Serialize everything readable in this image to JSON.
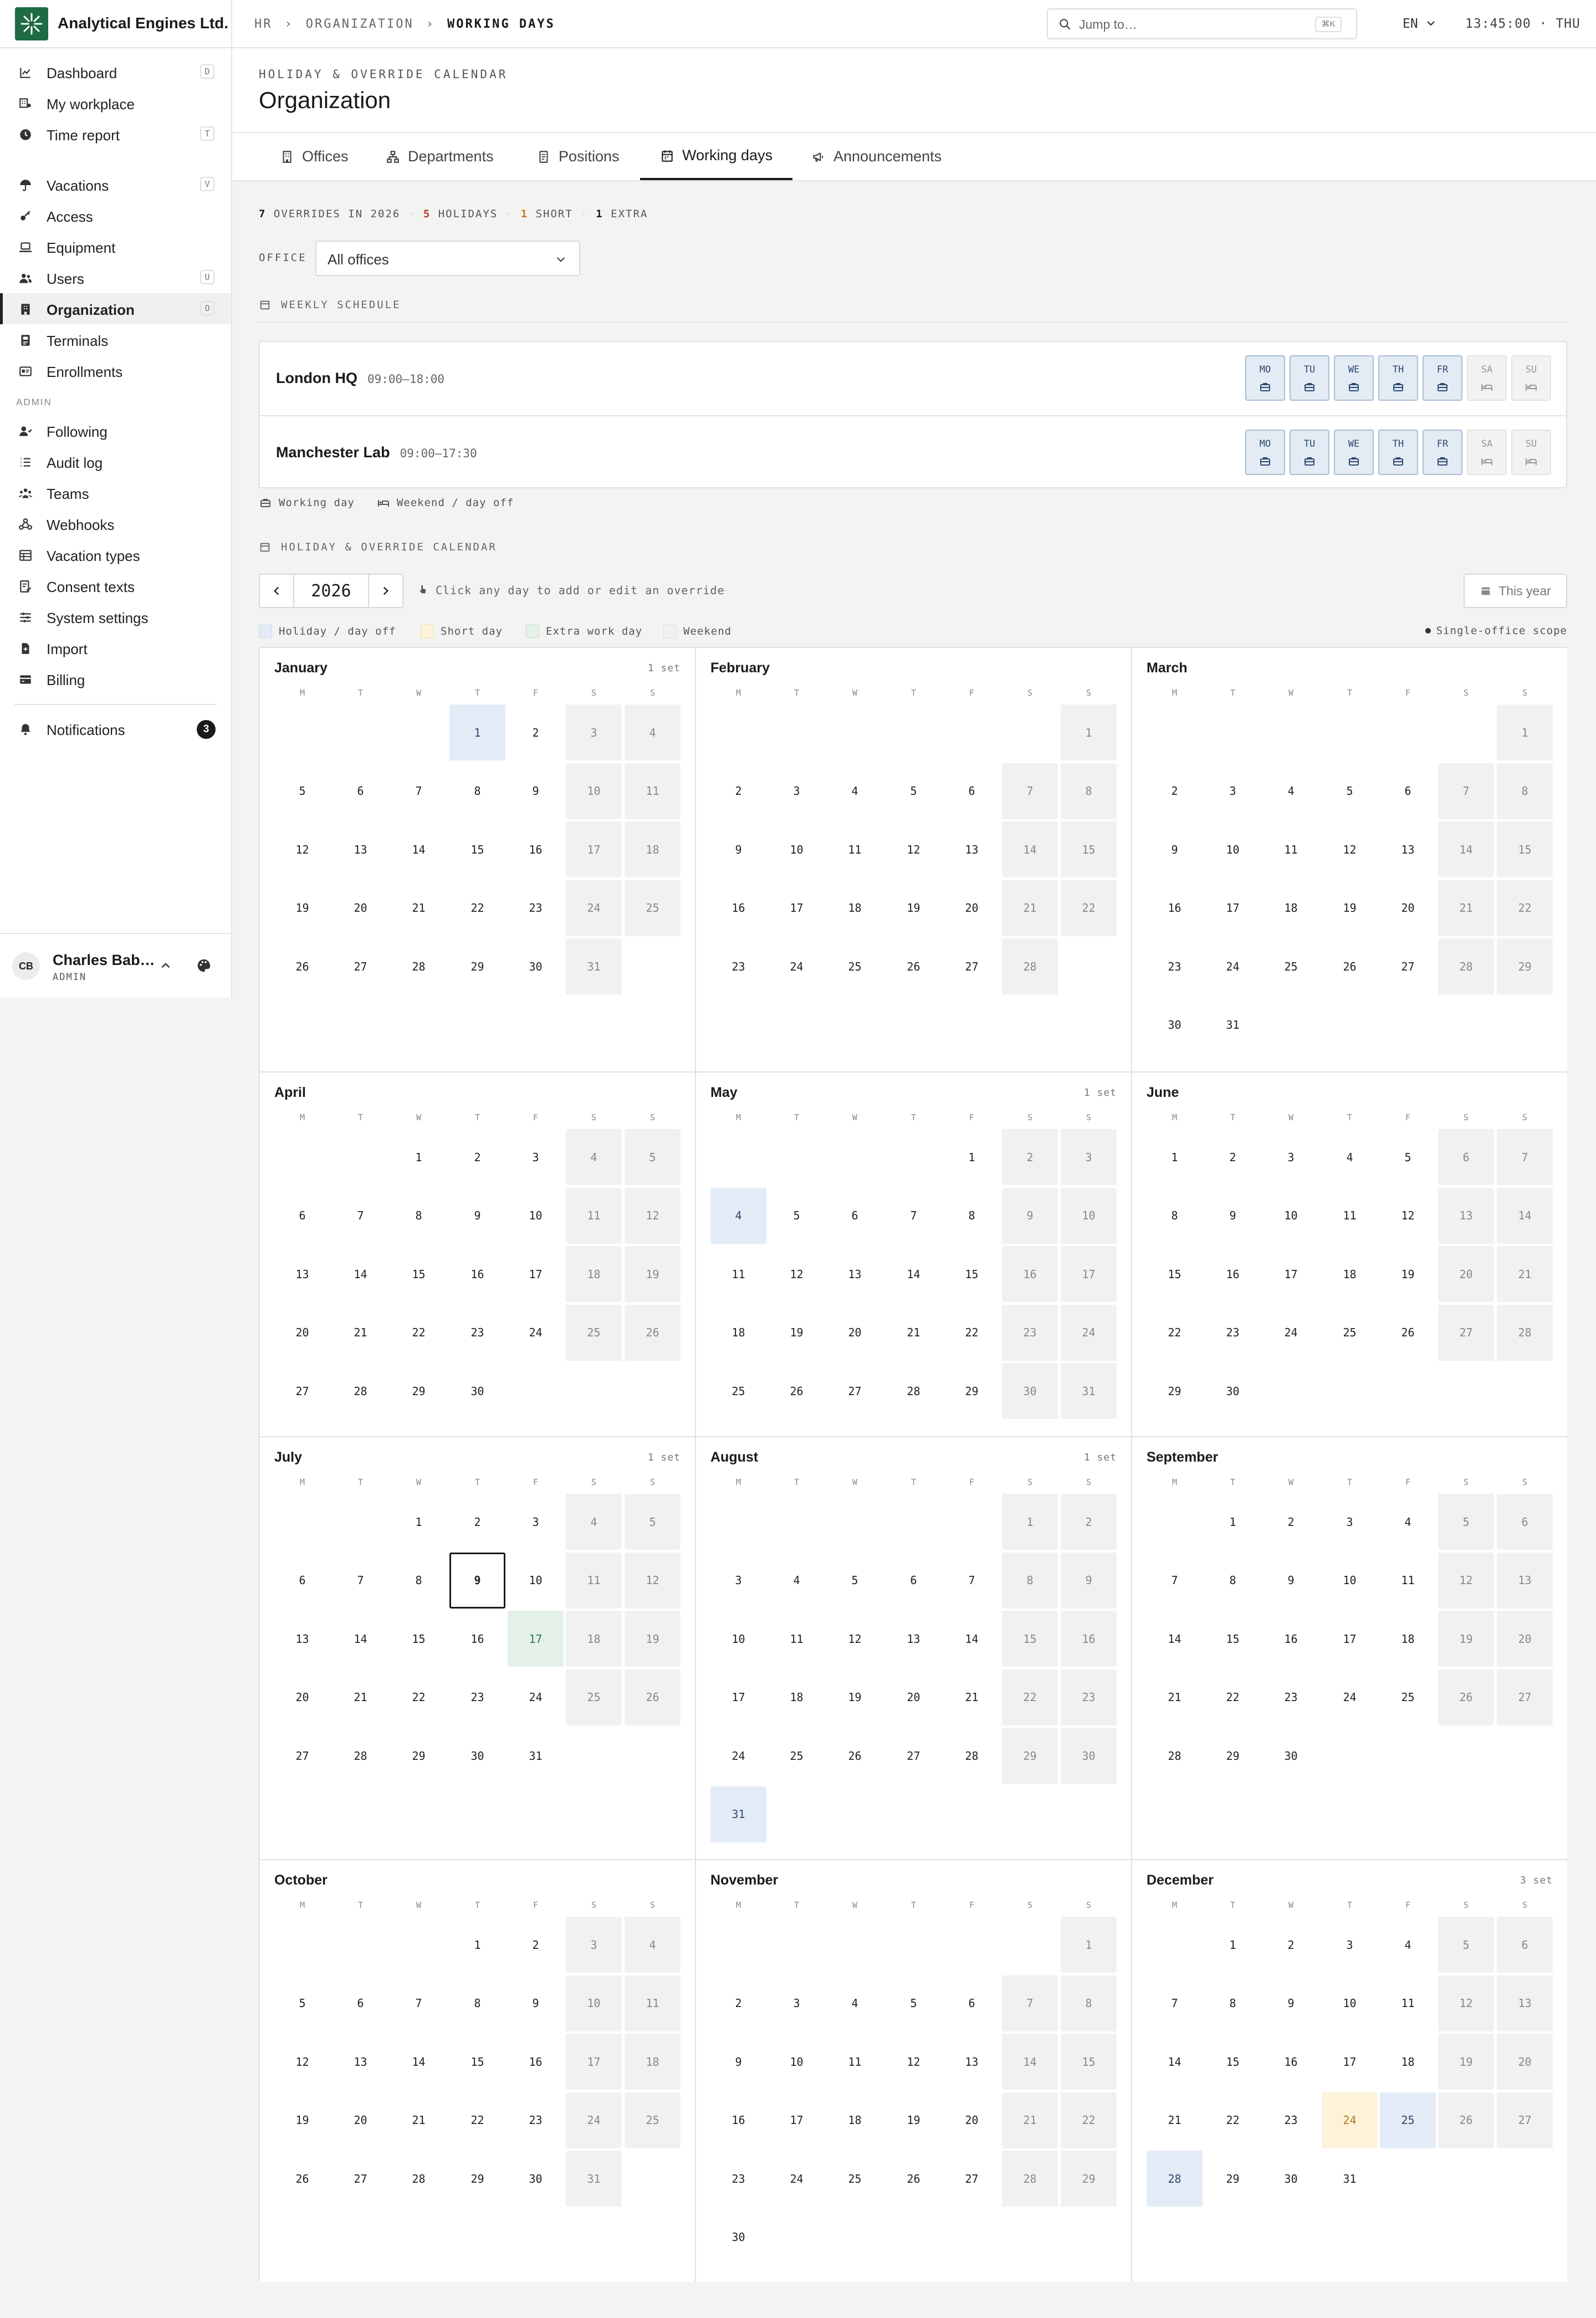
{
  "brand": {
    "name": "Analytical Engines Ltd.",
    "logo_color": "#1f6b43"
  },
  "breadcrumbs": [
    "HR",
    "ORGANIZATION",
    "WORKING DAYS"
  ],
  "search": {
    "placeholder": "Jump to…",
    "shortcut": "⌘K"
  },
  "language": "EN",
  "clock": "13:45:00 · THU",
  "sidebar": {
    "items": [
      {
        "label": "Dashboard",
        "icon": "chart-line-icon",
        "key": "D"
      },
      {
        "label": "My workplace",
        "icon": "workplace-icon",
        "key": ""
      },
      {
        "label": "Time report",
        "icon": "clock-icon",
        "key": "T"
      },
      {
        "label": "Vacations",
        "icon": "umbrella-icon",
        "key": "V"
      },
      {
        "label": "Access",
        "icon": "key-icon",
        "key": ""
      },
      {
        "label": "Equipment",
        "icon": "laptop-icon",
        "key": ""
      },
      {
        "label": "Users",
        "icon": "users-icon",
        "key": "U"
      },
      {
        "label": "Organization",
        "icon": "building-icon",
        "key": "O",
        "active": true
      },
      {
        "label": "Terminals",
        "icon": "terminal-icon",
        "key": ""
      },
      {
        "label": "Enrollments",
        "icon": "id-card-icon",
        "key": ""
      }
    ],
    "admin_label": "ADMIN",
    "admin_items": [
      {
        "label": "Following",
        "icon": "user-follow-icon"
      },
      {
        "label": "Audit log",
        "icon": "list-icon"
      },
      {
        "label": "Teams",
        "icon": "team-icon"
      },
      {
        "label": "Webhooks",
        "icon": "webhook-icon"
      },
      {
        "label": "Vacation types",
        "icon": "table-icon"
      },
      {
        "label": "Consent texts",
        "icon": "document-check-icon"
      },
      {
        "label": "System settings",
        "icon": "sliders-icon"
      },
      {
        "label": "Import",
        "icon": "file-import-icon"
      },
      {
        "label": "Billing",
        "icon": "credit-card-icon"
      }
    ],
    "notifications": {
      "label": "Notifications",
      "count": "3"
    },
    "user": {
      "initials": "CB",
      "name": "Charles Bab…",
      "role": "ADMIN"
    }
  },
  "page": {
    "kicker": "HOLIDAY & OVERRIDE CALENDAR",
    "title": "Organization"
  },
  "tabs": [
    {
      "label": "Offices",
      "icon": "office-icon"
    },
    {
      "label": "Departments",
      "icon": "sitemap-icon"
    },
    {
      "label": "Positions",
      "icon": "badge-icon"
    },
    {
      "label": "Working days",
      "icon": "calendar-icon",
      "active": true
    },
    {
      "label": "Announcements",
      "icon": "megaphone-icon"
    }
  ],
  "stats": {
    "overrides": "7",
    "overrides_label": "OVERRIDES IN 2026",
    "holidays": "5",
    "holidays_label": "HOLIDAYS",
    "short": "1",
    "short_label": "SHORT",
    "extra": "1",
    "extra_label": "EXTRA"
  },
  "office_filter": {
    "label": "OFFICE",
    "value": "All offices"
  },
  "weekly": {
    "heading": "WEEKLY SCHEDULE",
    "day_labels": [
      "MO",
      "TU",
      "WE",
      "TH",
      "FR",
      "SA",
      "SU"
    ],
    "offices": [
      {
        "name": "London HQ",
        "hours": "09:00–18:00",
        "working": [
          true,
          true,
          true,
          true,
          true,
          false,
          false
        ]
      },
      {
        "name": "Manchester Lab",
        "hours": "09:00–17:30",
        "working": [
          true,
          true,
          true,
          true,
          true,
          false,
          false
        ]
      }
    ],
    "legend_working": "Working day",
    "legend_off": "Weekend / day off"
  },
  "calendar": {
    "heading": "HOLIDAY & OVERRIDE CALENDAR",
    "year": "2026",
    "hint": "Click any day to add or edit an override",
    "this_year": "This year",
    "legend": [
      "Holiday / day off",
      "Short day",
      "Extra work day",
      "Weekend"
    ],
    "scope": "Single-office scope",
    "weekday_labels": [
      "M",
      "T",
      "W",
      "T",
      "F",
      "S",
      "S"
    ],
    "colors": {
      "holiday": "#e3ebf6",
      "short": "#fdf3da",
      "extra": "#e3f1e8",
      "weekend": "#f1f1f0"
    },
    "today": {
      "month": 7,
      "day": 9
    },
    "months": [
      {
        "name": "January",
        "count": "1 set",
        "start": 3,
        "days": 31,
        "overrides": {
          "1": "holiday"
        }
      },
      {
        "name": "February",
        "count": "",
        "start": 6,
        "days": 28,
        "overrides": {}
      },
      {
        "name": "March",
        "count": "",
        "start": 6,
        "days": 31,
        "overrides": {}
      },
      {
        "name": "April",
        "count": "",
        "start": 2,
        "days": 30,
        "overrides": {}
      },
      {
        "name": "May",
        "count": "1 set",
        "start": 4,
        "days": 31,
        "overrides": {
          "4": "holiday"
        }
      },
      {
        "name": "June",
        "count": "",
        "start": 0,
        "days": 30,
        "overrides": {}
      },
      {
        "name": "July",
        "count": "1 set",
        "start": 2,
        "days": 31,
        "overrides": {
          "17": "extra"
        }
      },
      {
        "name": "August",
        "count": "1 set",
        "start": 5,
        "days": 31,
        "overrides": {
          "31": "holiday"
        }
      },
      {
        "name": "September",
        "count": "",
        "start": 1,
        "days": 30,
        "overrides": {}
      },
      {
        "name": "October",
        "count": "",
        "start": 3,
        "days": 31,
        "overrides": {}
      },
      {
        "name": "November",
        "count": "",
        "start": 6,
        "days": 30,
        "overrides": {}
      },
      {
        "name": "December",
        "count": "3 set",
        "start": 1,
        "days": 31,
        "overrides": {
          "24": "short",
          "25": "holiday",
          "28": "holiday"
        }
      }
    ]
  }
}
